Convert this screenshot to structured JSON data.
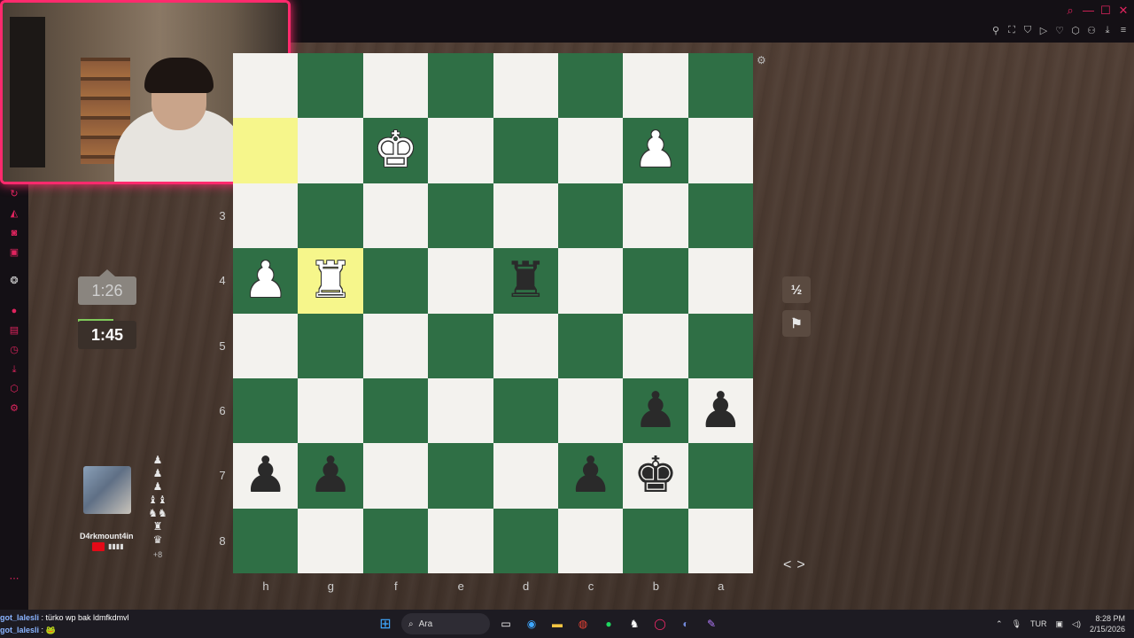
{
  "window": {
    "controls": [
      "search-icon",
      "minimize-icon",
      "maximize-icon",
      "close-icon"
    ]
  },
  "board": {
    "rank_labels": [
      "3",
      "4",
      "5",
      "6",
      "7",
      "8"
    ],
    "file_labels": [
      "h",
      "g",
      "f",
      "e",
      "d",
      "c",
      "b",
      "a"
    ],
    "squares": [
      [
        {
          "piece": "",
          "color": ""
        },
        {
          "piece": "",
          "color": ""
        },
        {
          "piece": "",
          "color": ""
        },
        {
          "piece": "",
          "color": ""
        },
        {
          "piece": "",
          "color": ""
        },
        {
          "piece": "",
          "color": ""
        },
        {
          "piece": "",
          "color": ""
        },
        {
          "piece": "",
          "color": ""
        }
      ],
      [
        {
          "piece": "",
          "color": "",
          "highlight": true
        },
        {
          "piece": "",
          "color": ""
        },
        {
          "piece": "♚",
          "color": "white"
        },
        {
          "piece": "",
          "color": ""
        },
        {
          "piece": "",
          "color": ""
        },
        {
          "piece": "",
          "color": ""
        },
        {
          "piece": "♟",
          "color": "white"
        },
        {
          "piece": "",
          "color": ""
        }
      ],
      [
        {
          "piece": "",
          "color": ""
        },
        {
          "piece": "",
          "color": ""
        },
        {
          "piece": "",
          "color": ""
        },
        {
          "piece": "",
          "color": ""
        },
        {
          "piece": "",
          "color": ""
        },
        {
          "piece": "",
          "color": ""
        },
        {
          "piece": "",
          "color": ""
        },
        {
          "piece": "",
          "color": ""
        }
      ],
      [
        {
          "piece": "♟",
          "color": "white"
        },
        {
          "piece": "♜",
          "color": "white",
          "highlight": true
        },
        {
          "piece": "",
          "color": ""
        },
        {
          "piece": "",
          "color": ""
        },
        {
          "piece": "♜",
          "color": "black"
        },
        {
          "piece": "",
          "color": ""
        },
        {
          "piece": "",
          "color": ""
        },
        {
          "piece": "",
          "color": ""
        }
      ],
      [
        {
          "piece": "",
          "color": ""
        },
        {
          "piece": "",
          "color": ""
        },
        {
          "piece": "",
          "color": ""
        },
        {
          "piece": "",
          "color": ""
        },
        {
          "piece": "",
          "color": ""
        },
        {
          "piece": "",
          "color": ""
        },
        {
          "piece": "",
          "color": ""
        },
        {
          "piece": "",
          "color": ""
        }
      ],
      [
        {
          "piece": "",
          "color": ""
        },
        {
          "piece": "",
          "color": ""
        },
        {
          "piece": "",
          "color": ""
        },
        {
          "piece": "",
          "color": ""
        },
        {
          "piece": "",
          "color": ""
        },
        {
          "piece": "",
          "color": ""
        },
        {
          "piece": "♟",
          "color": "black"
        },
        {
          "piece": "♟",
          "color": "black"
        }
      ],
      [
        {
          "piece": "♟",
          "color": "black"
        },
        {
          "piece": "♟",
          "color": "black"
        },
        {
          "piece": "",
          "color": ""
        },
        {
          "piece": "",
          "color": ""
        },
        {
          "piece": "",
          "color": ""
        },
        {
          "piece": "♟",
          "color": "black"
        },
        {
          "piece": "♚",
          "color": "black"
        },
        {
          "piece": "",
          "color": ""
        }
      ],
      [
        {
          "piece": "",
          "color": ""
        },
        {
          "piece": "",
          "color": ""
        },
        {
          "piece": "",
          "color": ""
        },
        {
          "piece": "",
          "color": ""
        },
        {
          "piece": "",
          "color": ""
        },
        {
          "piece": "",
          "color": ""
        },
        {
          "piece": "",
          "color": ""
        },
        {
          "piece": "",
          "color": ""
        }
      ]
    ]
  },
  "clocks": {
    "opponent": "1:26",
    "player": "1:45"
  },
  "controls": {
    "draw_label": "½",
    "resign_icon": "flag-icon"
  },
  "player": {
    "name": "D4rkmount4in",
    "country_color": "#e30a17",
    "rating_dots": "▮▮▮▮",
    "captured": [
      "♟",
      "♟",
      "♟",
      "♝♝",
      "♞♞",
      "♜",
      "♛"
    ],
    "captured_extra": "+8"
  },
  "chat": [
    {
      "user": "got_lalesli",
      "message": "türko wp bak ldmfkdmvl"
    },
    {
      "user": "got_lalesli",
      "message": "🐸"
    }
  ],
  "taskbar": {
    "search_placeholder": "Ara",
    "language": "TUR",
    "time": "8:28 PM",
    "date": "2/15/2026"
  },
  "colors": {
    "accent": "#ff2a6d",
    "board_dark": "#2f6f45",
    "board_light": "#f3f2ee",
    "highlight": "#f6f68b"
  }
}
